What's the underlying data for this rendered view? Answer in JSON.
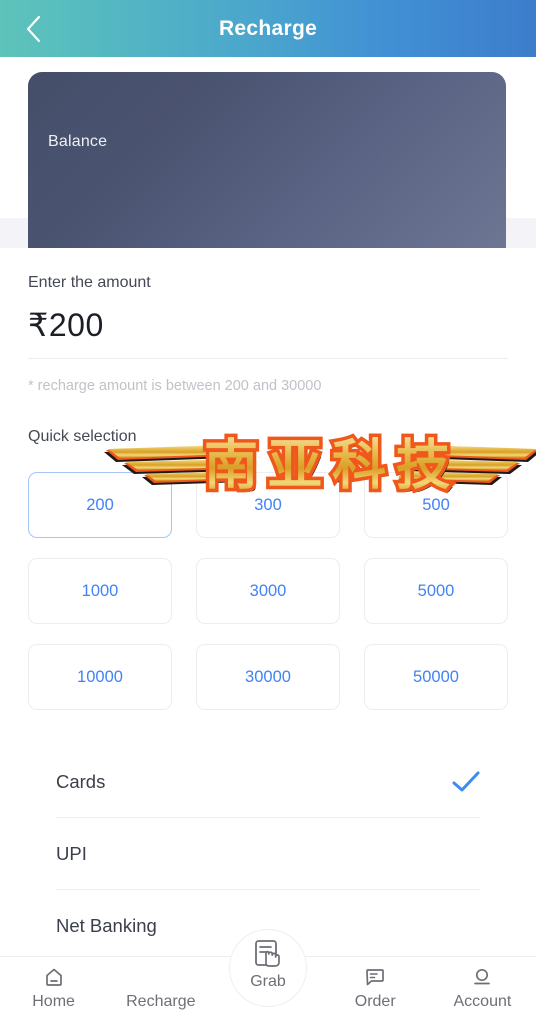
{
  "header": {
    "title": "Recharge",
    "back_icon": "chevron-left-icon",
    "gradient_start": "#5ec3ba",
    "gradient_end": "#3d7dcb"
  },
  "balance_card": {
    "label": "Balance",
    "bg_start": "#454e69",
    "bg_end": "#6d7693"
  },
  "amount": {
    "label": "Enter the amount",
    "value": "₹200",
    "currency_symbol": "₹",
    "number": "200",
    "hint": "* recharge amount is between 200 and 30000",
    "min": 200,
    "max": 30000
  },
  "quick_select": {
    "label": "Quick selection",
    "selected_value": "200",
    "accent_color": "#4083f5",
    "selected_border_color": "#a5c6f5",
    "options": [
      {
        "label": "200",
        "selected": true
      },
      {
        "label": "300",
        "selected": false
      },
      {
        "label": "500",
        "selected": false
      },
      {
        "label": "1000",
        "selected": false
      },
      {
        "label": "3000",
        "selected": false
      },
      {
        "label": "5000",
        "selected": false
      },
      {
        "label": "10000",
        "selected": false
      },
      {
        "label": "30000",
        "selected": false
      },
      {
        "label": "50000",
        "selected": false
      }
    ]
  },
  "payment_methods": {
    "check_color": "#3d8bf2",
    "items": [
      {
        "label": "Cards",
        "selected": true
      },
      {
        "label": "UPI",
        "selected": false
      },
      {
        "label": "Net Banking",
        "selected": false
      }
    ]
  },
  "watermark": {
    "text": "南亚科技",
    "gold_color": "#e8b23a",
    "outline_color": "#f0571b",
    "shadow_color": "#1d1a17"
  },
  "bottom_nav": {
    "items": [
      {
        "label": "Home",
        "icon": "home-icon"
      },
      {
        "label": "Recharge",
        "icon": ""
      },
      {
        "label": "Grab",
        "icon": "grab-hand-icon"
      },
      {
        "label": "Order",
        "icon": "order-doc-icon"
      },
      {
        "label": "Account",
        "icon": "account-person-icon"
      }
    ]
  }
}
